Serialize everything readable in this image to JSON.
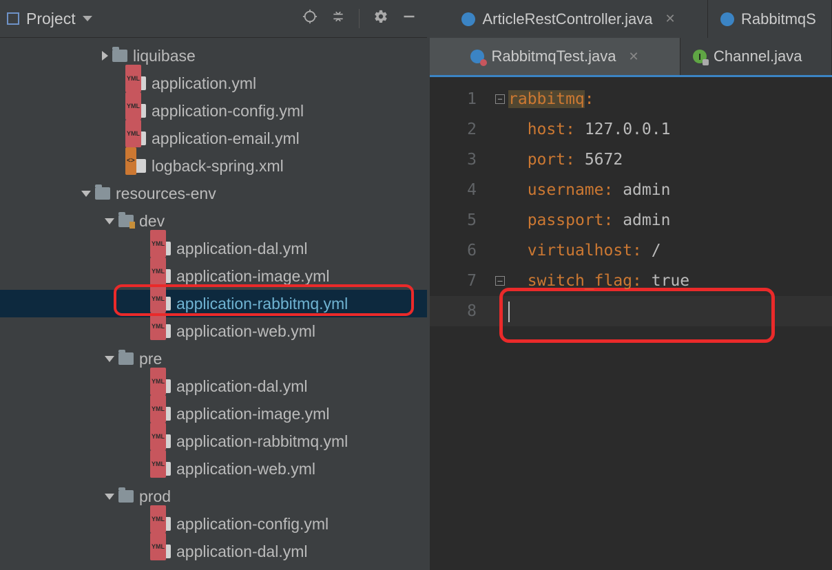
{
  "project_label": "Project",
  "tree": {
    "liquibase": "liquibase",
    "app_yml": "application.yml",
    "app_cfg": "application-config.yml",
    "app_email": "application-email.yml",
    "logback": "logback-spring.xml",
    "res_env": "resources-env",
    "dev": "dev",
    "dev_dal": "application-dal.yml",
    "dev_img": "application-image.yml",
    "dev_rmq": "application-rabbitmq.yml",
    "dev_web": "application-web.yml",
    "pre": "pre",
    "pre_dal": "application-dal.yml",
    "pre_img": "application-image.yml",
    "pre_rmq": "application-rabbitmq.yml",
    "pre_web": "application-web.yml",
    "prod": "prod",
    "prod_cfg": "application-config.yml",
    "prod_dal": "application-dal.yml"
  },
  "tabs": {
    "t1": "ArticleRestController.java",
    "t2": "RabbitmqS",
    "t3": "RabbitmqTest.java",
    "t4": "Channel.java"
  },
  "code": {
    "l1_key": "rabbitmq",
    "l2_key": "host",
    "l2_val": "127.0.0.1",
    "l3_key": "port",
    "l3_val": "5672",
    "l4_key": "username",
    "l4_val": "admin",
    "l5_key": "passport",
    "l5_val": "admin",
    "l6_key": "virtualhost",
    "l6_val": "/",
    "l7_key": "switch_flag",
    "l7_val": "true"
  },
  "lines": {
    "n1": "1",
    "n2": "2",
    "n3": "3",
    "n4": "4",
    "n5": "5",
    "n6": "6",
    "n7": "7",
    "n8": "8"
  }
}
